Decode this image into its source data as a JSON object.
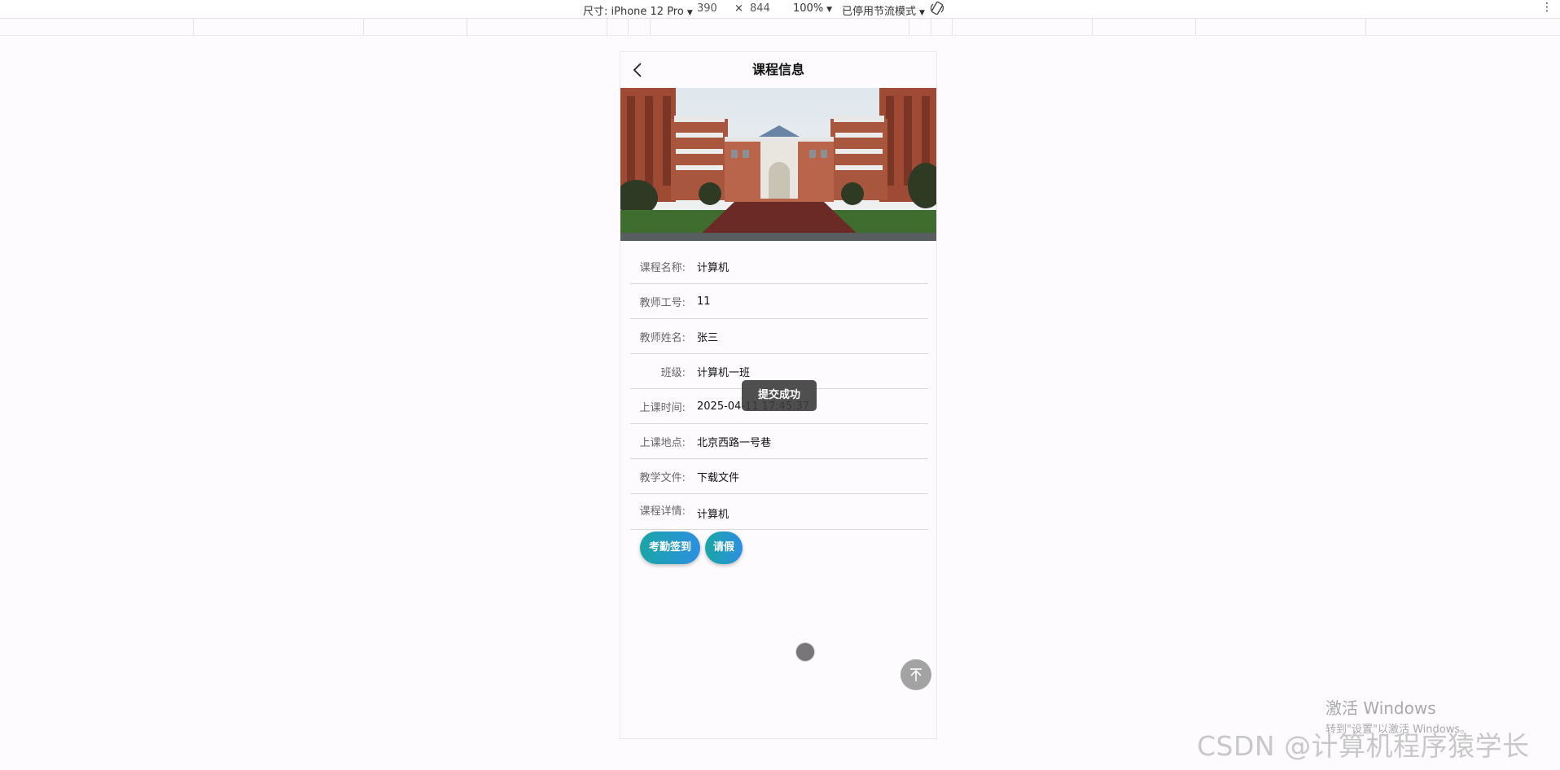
{
  "devtools": {
    "dimensions_label": "尺寸: iPhone 12 Pro",
    "width": "390",
    "times": "×",
    "height": "844",
    "zoom": "100%",
    "throttle": "已停用节流模式"
  },
  "page": {
    "title": "课程信息",
    "banner_icon": "campus-building-image",
    "fields": [
      {
        "label": "课程名称:",
        "value": "计算机"
      },
      {
        "label": "教师工号:",
        "value": "11"
      },
      {
        "label": "教师姓名:",
        "value": "张三"
      },
      {
        "label": "班级:",
        "value": "计算机一班"
      },
      {
        "label": "上课时间:",
        "value": "2025-04-11 17:45:37"
      },
      {
        "label": "上课地点:",
        "value": "北京西路一号巷"
      },
      {
        "label": "教学文件:",
        "value": "下载文件"
      },
      {
        "label": "课程详情:",
        "value": "计算机"
      }
    ],
    "buttons": {
      "checkin": "考勤签到",
      "leave": "请假"
    },
    "toast": "提交成功"
  },
  "watermark": {
    "activate_title": "激活 Windows",
    "activate_sub": "转到\"设置\"以激活 Windows。",
    "csdn": "CSDN @计算机程序猿学长"
  },
  "colors": {
    "button_gradient_start": "#1aa6a6",
    "button_gradient_end": "#2c8fe0",
    "toast_bg": "#3c3c3c"
  }
}
